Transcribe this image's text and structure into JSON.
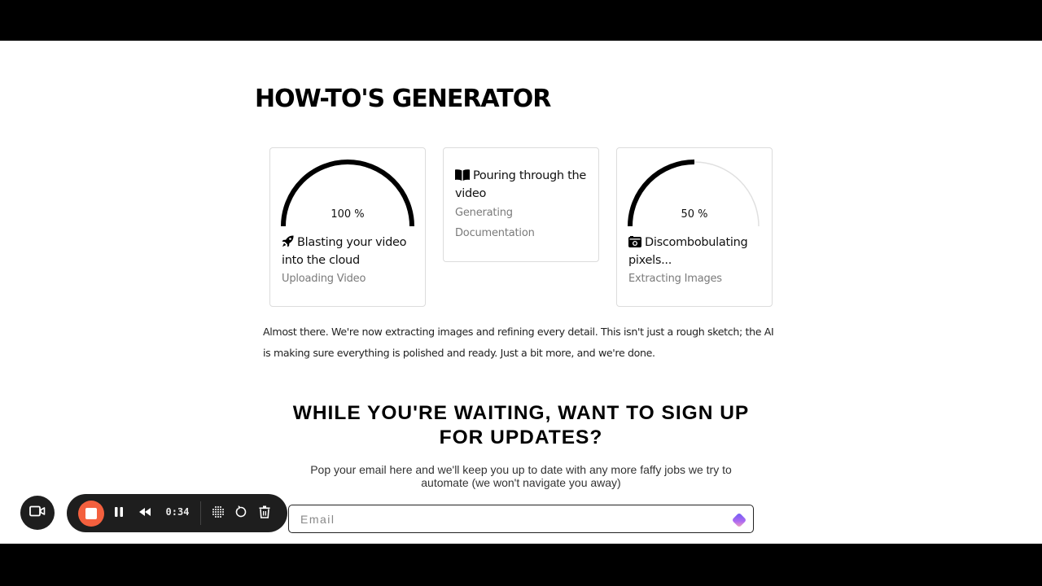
{
  "page": {
    "title": "HOW-TO'S GENERATOR"
  },
  "steps": [
    {
      "icon": "rocket-icon",
      "title": "Blasting your video into the cloud",
      "subtitle": "Uploading Video",
      "progress_percent": 100,
      "progress_label": "100 %"
    },
    {
      "icon": "book-open-icon",
      "title": "Pouring through the video",
      "subtitle": "Generating Documentation"
    },
    {
      "icon": "camera-retro-icon",
      "title": "Discombobulating pixels...",
      "subtitle": "Extracting Images",
      "progress_percent": 50,
      "progress_label": "50 %"
    }
  ],
  "status_message": "Almost there. We're now extracting images and refining every detail. This isn't just a rough sketch; the AI is making sure everything is polished and ready. Just a bit more, and we're done.",
  "signup": {
    "heading": "WHILE YOU'RE WAITING, WANT TO SIGN UP FOR UPDATES?",
    "description": "Pop your email here and we'll keep you up to date with any more faffy jobs we try to automate (we won't navigate you away)",
    "email_placeholder": "Email",
    "email_value": ""
  },
  "recorder": {
    "elapsed_time": "0:34",
    "colors": {
      "stop_button": "#f4603e",
      "bar_background": "#1e1e1e"
    }
  },
  "colors": {
    "gauge_fill": "#000000",
    "gauge_track": "#e0e0e0",
    "subtitle_text": "#7a7a7a"
  }
}
